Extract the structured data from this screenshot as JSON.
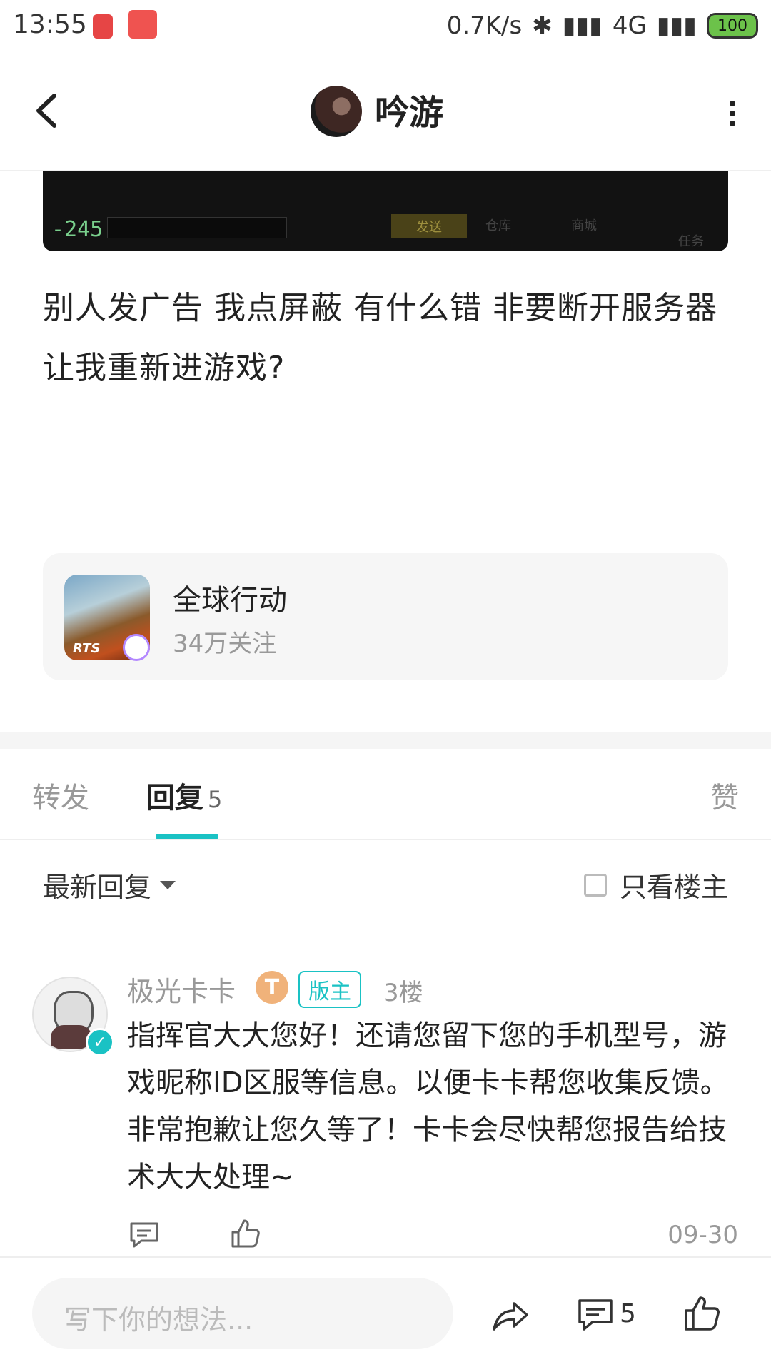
{
  "status": {
    "time": "13:55",
    "net_speed": "0.7K/s",
    "network": "4G",
    "battery": "100"
  },
  "header": {
    "title": "吟游"
  },
  "post": {
    "image": {
      "score": "-245",
      "send_label": "发送",
      "icons": [
        "仓库",
        "商城",
        "任务"
      ]
    },
    "text": "别人发广告  我点屏蔽 有什么错 非要断开服务器让我重新进游戏?"
  },
  "game": {
    "icon_label": "RTS",
    "name": "全球行动",
    "followers": "34万关注"
  },
  "tabs": {
    "forward": "转发",
    "reply": "回复",
    "reply_count": "5",
    "like": "赞"
  },
  "filter": {
    "sort": "最新回复",
    "only_op": "只看楼主"
  },
  "comment": {
    "author": "极光卡卡",
    "level": "T",
    "role": "版主",
    "floor": "3楼",
    "text": "指挥官大大您好！还请您留下您的手机型号，游戏昵称ID区服等信息。以便卡卡帮您收集反馈。非常抱歉让您久等了！卡卡会尽快帮您报告给技术大大处理~",
    "date": "09-30"
  },
  "bottom": {
    "input_placeholder": "写下你的想法...",
    "comment_count": "5"
  }
}
